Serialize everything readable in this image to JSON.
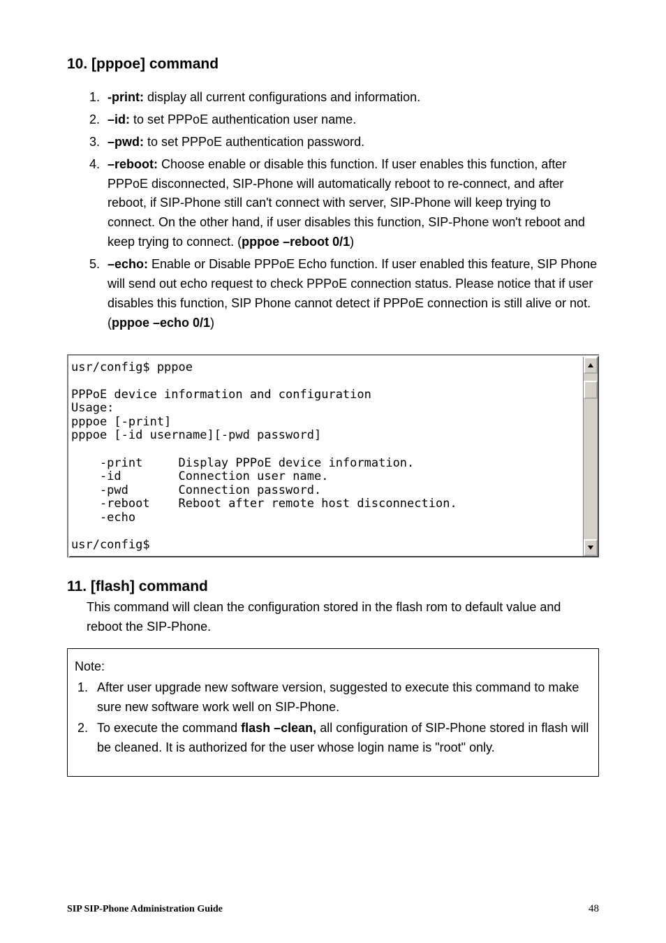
{
  "sections": {
    "pppoe": {
      "heading": "10. [pppoe] command",
      "items": [
        {
          "term": "-print:",
          "desc": " display all current configurations and information."
        },
        {
          "term": "–id:",
          "desc": " to set PPPoE authentication user name."
        },
        {
          "term": "–pwd:",
          "desc": " to set PPPoE authentication password."
        },
        {
          "term": "–reboot:",
          "desc": " Choose enable or disable this function. If user enables this function, after PPPoE disconnected, SIP-Phone will automatically reboot to re-connect, and after reboot, if SIP-Phone still can't connect with server, SIP-Phone will keep trying to connect. On the other hand, if user disables this function, SIP-Phone won't reboot and keep trying to connect. (",
          "cmd": "pppoe –reboot 0/1",
          "tail": ")"
        },
        {
          "term": "–echo:",
          "desc": " Enable or Disable PPPoE Echo function. If user enabled this feature, SIP Phone will send out echo request to check PPPoE connection status. Please notice that if user disables this function, SIP Phone cannot detect if PPPoE connection is still alive or not. (",
          "cmd": "pppoe –echo 0/1",
          "tail": ")"
        }
      ]
    },
    "terminal": {
      "text": "usr/config$ pppoe\n\nPPPoE device information and configuration\nUsage:\npppoe [-print]\npppoe [-id username][-pwd password]\n\n    -print     Display PPPoE device information.\n    -id        Connection user name.\n    -pwd       Connection password.\n    -reboot    Reboot after remote host disconnection.\n    -echo\n\nusr/config$"
    },
    "flash": {
      "heading": "11. [flash] command",
      "intro": "This command will clean the configuration stored in the flash rom to default value and reboot the SIP-Phone."
    },
    "note": {
      "title": "Note:",
      "items": [
        {
          "text1": "After user upgrade new software version, suggested to execute this command to make sure new software work well on SIP-Phone."
        },
        {
          "text1": "To execute the command ",
          "cmd": "flash –clean,",
          "text2": " all configuration of SIP-Phone stored in flash will be cleaned. It is authorized for the user whose login name is \"root\" only."
        }
      ]
    }
  },
  "footer": {
    "left": "SIP SIP-Phone    Administration Guide",
    "right": "48"
  }
}
